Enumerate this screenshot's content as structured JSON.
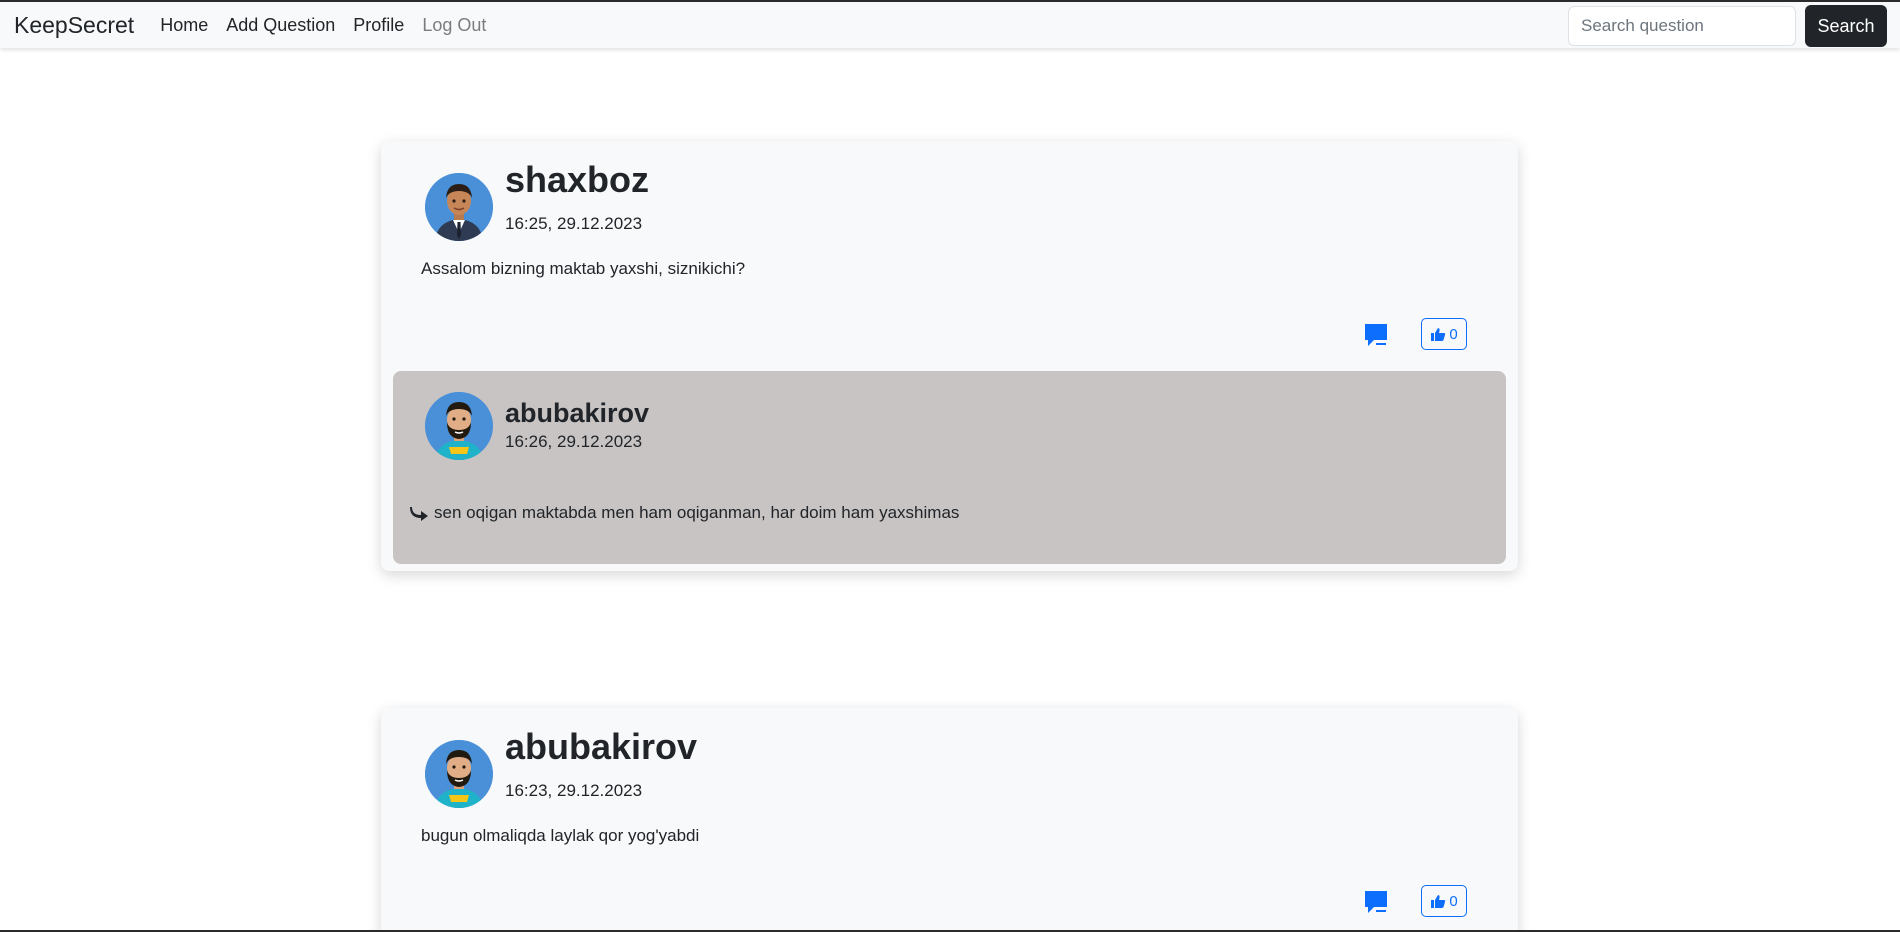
{
  "navbar": {
    "brand": "KeepSecret",
    "links": [
      {
        "label": "Home"
      },
      {
        "label": "Add Question"
      },
      {
        "label": "Profile"
      },
      {
        "label": "Log Out"
      }
    ],
    "search": {
      "placeholder": "Search question",
      "value": "",
      "button_label": "Search"
    }
  },
  "posts": [
    {
      "author": "shaxboz",
      "timestamp": "16:25, 29.12.2023",
      "text": "Assalom bizning maktab yaxshi, siznikichi?",
      "like_count": "0",
      "avatar_icon": "avatar-businessman-icon",
      "replies": [
        {
          "author": "abubakirov",
          "timestamp": "16:26, 29.12.2023",
          "text": "sen oqigan maktabda men ham oqiganman, har doim ham yaxshimas",
          "avatar_icon": "avatar-bearded-man-icon"
        }
      ]
    },
    {
      "author": "abubakirov",
      "timestamp": "16:23, 29.12.2023",
      "text": "bugun olmaliqda laylak qor yog'yabdi",
      "like_count": "0",
      "avatar_icon": "avatar-bearded-man-icon"
    }
  ],
  "colors": {
    "accent": "#0d6efd",
    "navbar_bg": "#f8f9fa",
    "card_bg": "#f8f9fa",
    "reply_bg": "#c8c4c4",
    "dark_button": "#212529",
    "avatar_bg": "#4a90d9"
  }
}
